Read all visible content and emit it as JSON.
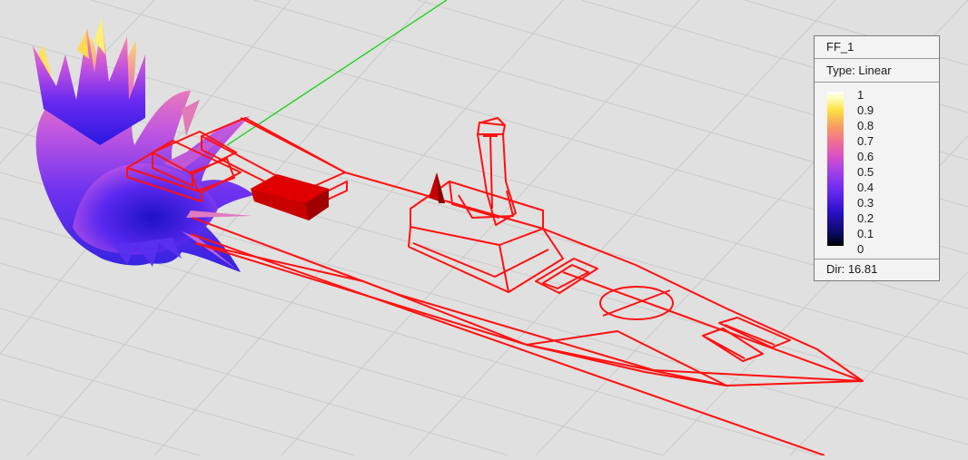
{
  "legend": {
    "name": "FF_1",
    "type": "Type: Linear",
    "ticks": [
      "1",
      "0.9",
      "0.8",
      "0.7",
      "0.6",
      "0.5",
      "0.4",
      "0.3",
      "0.2",
      "0.1",
      "0"
    ],
    "dir": "Dir: 16.81",
    "colormap": [
      "#000000",
      "#0a0a60",
      "#2a10c8",
      "#6a2af0",
      "#a040e8",
      "#d850c8",
      "#f27090",
      "#f8a060",
      "#fde040",
      "#ffffff"
    ]
  },
  "scene": {
    "grid_color": "#c8c8c8",
    "background": "#e0e0e0",
    "model_color": "#ff0000",
    "axis_color": "#00d000",
    "icons": [
      "radiation-pattern",
      "ship-wireframe",
      "green-axis-line"
    ]
  }
}
